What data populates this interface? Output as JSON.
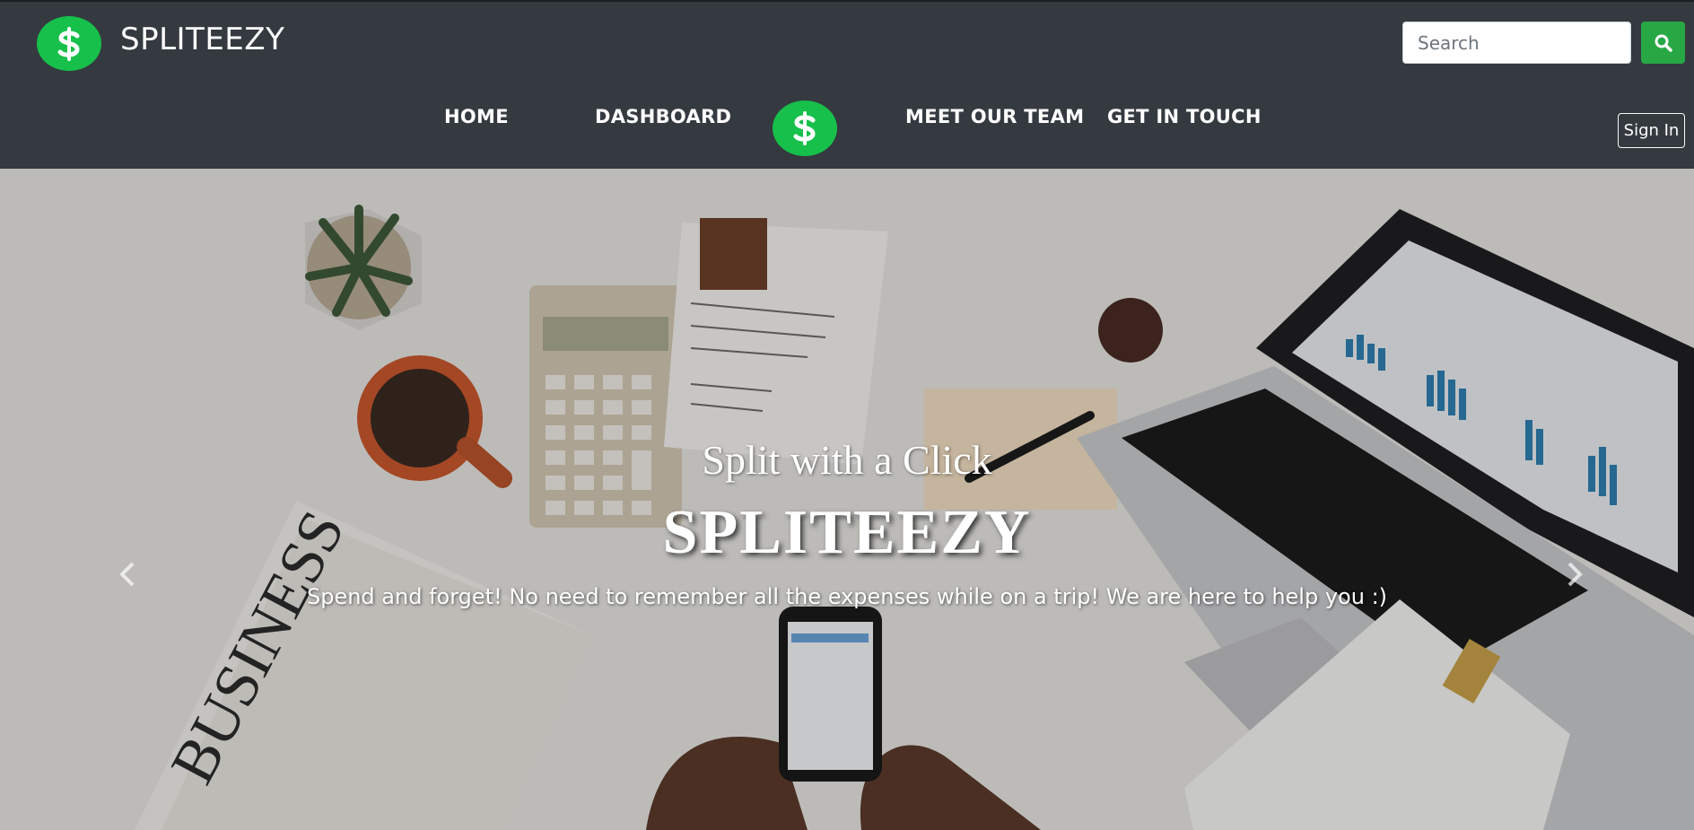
{
  "brand": {
    "name": "SPLITEEZY",
    "logo_icon": "dollar-icon",
    "accent": "#17c04a"
  },
  "search": {
    "placeholder": "Search",
    "button_icon": "search-icon",
    "button_color": "#28a745"
  },
  "nav": {
    "items": [
      {
        "label": "HOME"
      },
      {
        "label": "DASHBOARD"
      },
      {
        "label": "MEET OUR TEAM"
      },
      {
        "label": "GET IN TOUCH"
      }
    ],
    "center_logo_icon": "dollar-icon"
  },
  "auth": {
    "signin_label": "Sign In"
  },
  "hero": {
    "subtitle": "Split with a Click",
    "title": "SPLITEEZY",
    "text": "Spend and forget! No need to remember all the expenses while on a trip! We are here to help you :)",
    "prev_icon": "chevron-left-icon",
    "next_icon": "chevron-right-icon"
  },
  "colors": {
    "header_bg": "#343a40",
    "text": "#ffffff"
  }
}
